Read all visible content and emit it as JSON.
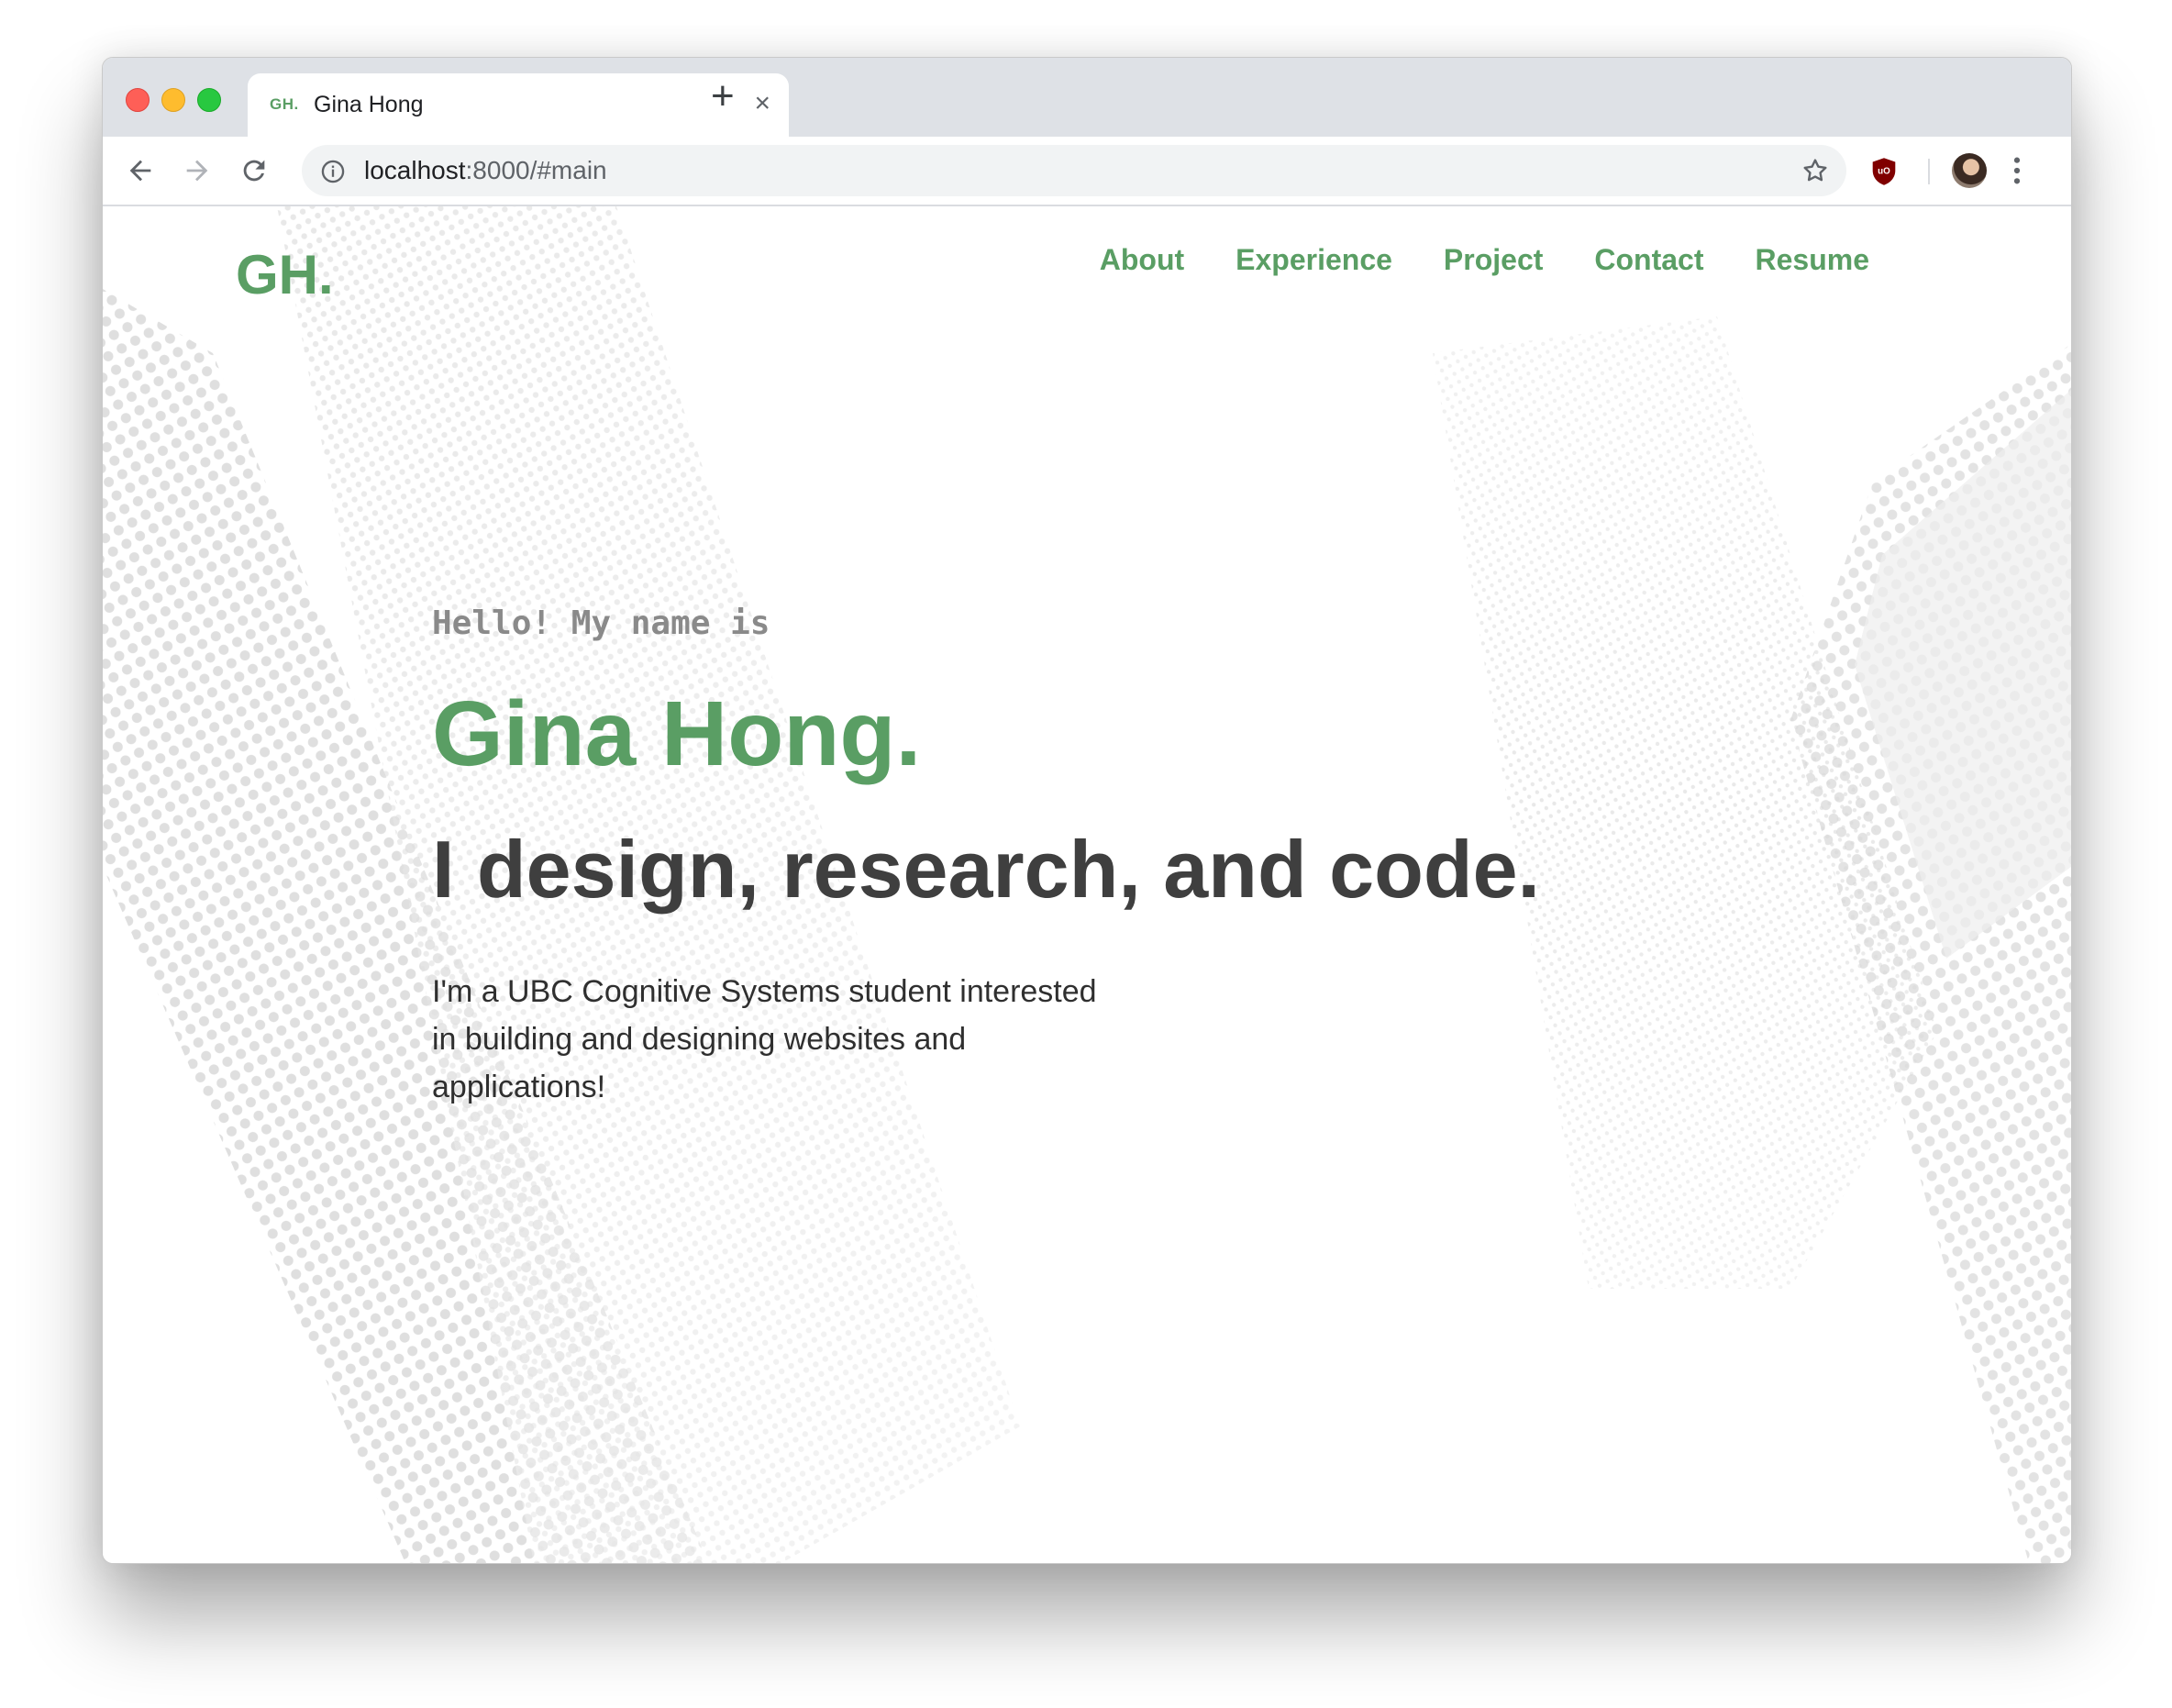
{
  "browser": {
    "tab": {
      "favicon_text": "GH.",
      "title": "Gina Hong"
    },
    "address": {
      "host": "localhost",
      "rest": ":8000/#main"
    }
  },
  "site": {
    "logo": "GH.",
    "nav": [
      "About",
      "Experience",
      "Project",
      "Contact",
      "Resume"
    ],
    "hero": {
      "greeting": "Hello! My name is",
      "name": "Gina Hong.",
      "tagline": "I design, research, and code.",
      "bio": "I'm a UBC Cognitive Systems student interested in building and designing websites and applications!"
    }
  },
  "colors": {
    "accent": "#5a9e64",
    "heading": "#3f3f3f",
    "greeting": "#8a8a8a"
  },
  "icons": [
    "close-icon",
    "plus-icon",
    "back-arrow-icon",
    "forward-arrow-icon",
    "reload-icon",
    "info-icon",
    "star-icon",
    "ublock-shield-icon",
    "profile-avatar",
    "more-vert-icon"
  ]
}
